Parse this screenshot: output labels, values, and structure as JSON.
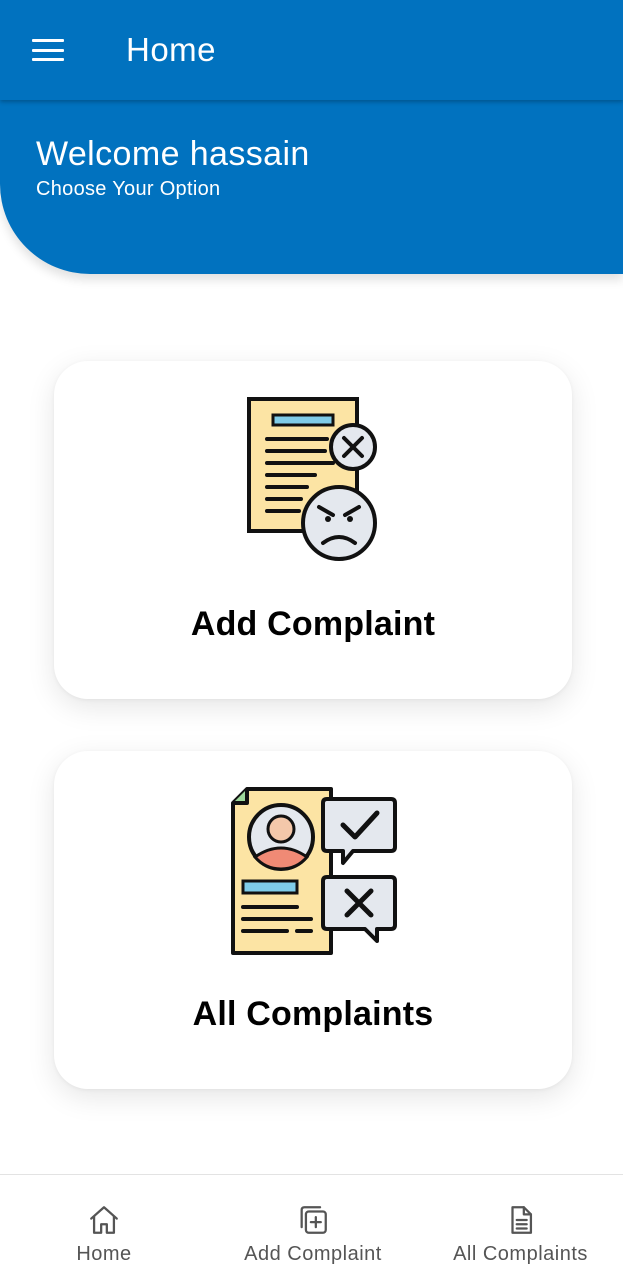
{
  "appbar": {
    "title": "Home",
    "menu_icon": "hamburger-menu-icon",
    "color": "#0172BF"
  },
  "welcome": {
    "title": "Welcome hassain",
    "subtitle": "Choose Your Option"
  },
  "cards": [
    {
      "label": "Add Complaint",
      "icon": "angry-document-icon"
    },
    {
      "label": "All Complaints",
      "icon": "profile-document-feedback-icon"
    }
  ],
  "bottom_nav": [
    {
      "label": "Home",
      "icon": "home-icon"
    },
    {
      "label": "Add Complaint",
      "icon": "add-square-icon"
    },
    {
      "label": "All Complaints",
      "icon": "document-icon"
    }
  ],
  "colors": {
    "primary": "#0172BF",
    "paper": "#FCE4A4",
    "accent_blue": "#7FCCE8",
    "face": "#E4E8EE",
    "skin": "#F4C8AA",
    "shirt": "#F08A75"
  }
}
